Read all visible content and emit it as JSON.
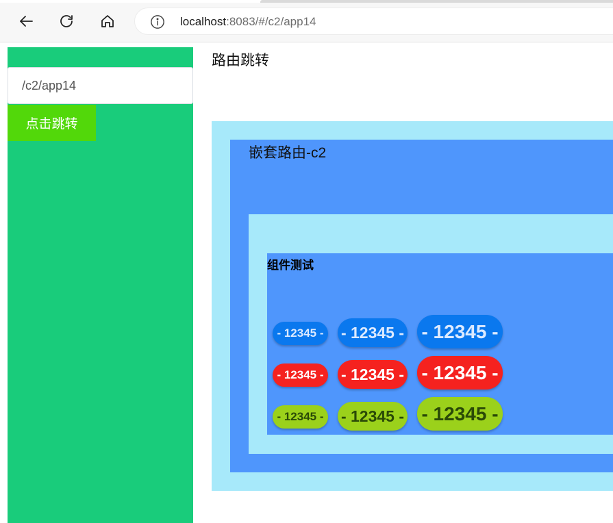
{
  "browser": {
    "url_host": "localhost",
    "url_rest": ":8083/#/c2/app14",
    "icons": {
      "back": "back-arrow-icon",
      "reload": "reload-icon",
      "home": "home-icon",
      "info": "info-icon"
    }
  },
  "sidebar": {
    "route_input_value": "/c2/app14",
    "jump_button_label": "点击跳转",
    "color": "#19cc7b"
  },
  "main": {
    "title": "路由跳转",
    "nested_title": "嵌套路由-c2",
    "component_title": "组件测试",
    "badges": {
      "blue": [
        "- 12345 -",
        "- 12345 -",
        "- 12345 -"
      ],
      "red": [
        "- 12345 -",
        "- 12345 -",
        "- 12345 -"
      ],
      "green": [
        "- 12345 -",
        "- 12345 -",
        "- 12345 -"
      ]
    }
  },
  "colors": {
    "light_blue": "#a7e9fa",
    "mid_blue": "#4f96fc",
    "badge_blue": "#0a78ee",
    "badge_red": "#f5221f",
    "badge_green": "#9bd11b",
    "button_green": "#52d80a"
  }
}
